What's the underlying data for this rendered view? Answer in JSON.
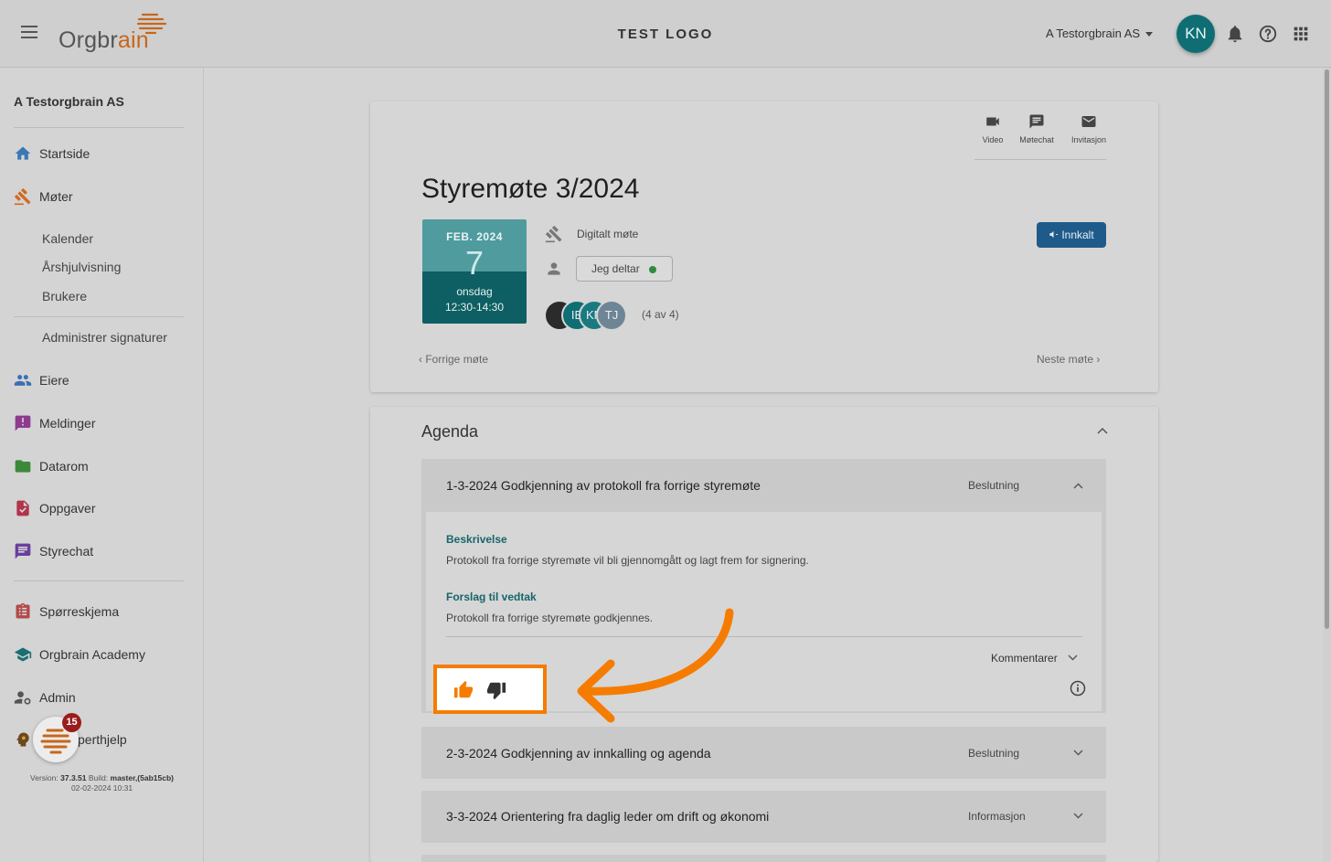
{
  "header": {
    "brand_prefix": "Orgbr",
    "brand_suffix": "ain",
    "center_logo": "TEST LOGO",
    "org_name": "A Testorgbrain AS",
    "user_initials": "KN",
    "icons": [
      "bell-icon",
      "help-icon",
      "apps-grid-icon"
    ]
  },
  "sidebar": {
    "company": "A Testorgbrain AS",
    "items": {
      "startside": "Startside",
      "moter": "Møter",
      "kalender": "Kalender",
      "arshjul": "Årshjulvisning",
      "brukere": "Brukere",
      "signaturer": "Administrer signaturer",
      "eiere": "Eiere",
      "meldinger": "Meldinger",
      "datarom": "Datarom",
      "oppgaver": "Oppgaver",
      "styrechat": "Styrechat",
      "sporreskjema": "Spørreskjema",
      "academy": "Orgbrain Academy",
      "admin": "Admin",
      "ekspert": "Få eksperthjelp"
    },
    "chat_badge": "15",
    "version_label": "Version:",
    "version": "37.3.51",
    "build_label": "Build:",
    "build": "master,(5ab15cb)",
    "build_date": "02-02-2024 10:31"
  },
  "meeting": {
    "tools": {
      "video": "Video",
      "motechat": "Møtechat",
      "invitasjon": "Invitasjon"
    },
    "title": "Styremøte 3/2024",
    "date": {
      "month_year": "FEB. 2024",
      "day": "7",
      "weekday": "onsdag",
      "time": "12:30-14:30"
    },
    "meeting_type": "Digitalt møte",
    "attending_label": "Jeg deltar",
    "participants": [
      "IE",
      "KN",
      "TJ"
    ],
    "participant_count": "(4 av 4)",
    "status": "Innkalt",
    "prev": "Forrige møte",
    "next": "Neste møte"
  },
  "agenda": {
    "title": "Agenda",
    "items": [
      {
        "title": "1-3-2024 Godkjenning av protokoll fra forrige styremøte",
        "type": "Beslutning",
        "description_label": "Beskrivelse",
        "description": "Protokoll fra forrige styremøte vil bli gjennomgått og lagt frem for signering.",
        "proposal_label": "Forslag til vedtak",
        "proposal": "Protokoll fra forrige styremøte godkjennes.",
        "comments_label": "Kommentarer"
      },
      {
        "title": "2-3-2024 Godkjenning av innkalling og agenda",
        "type": "Beslutning"
      },
      {
        "title": "3-3-2024 Orientering fra daglig leder om drift og økonomi",
        "type": "Informasjon"
      }
    ]
  },
  "colors": {
    "accent_teal": "#0e6e73",
    "highlight_orange": "#f57c00",
    "status_blue": "#1f5b8a"
  }
}
